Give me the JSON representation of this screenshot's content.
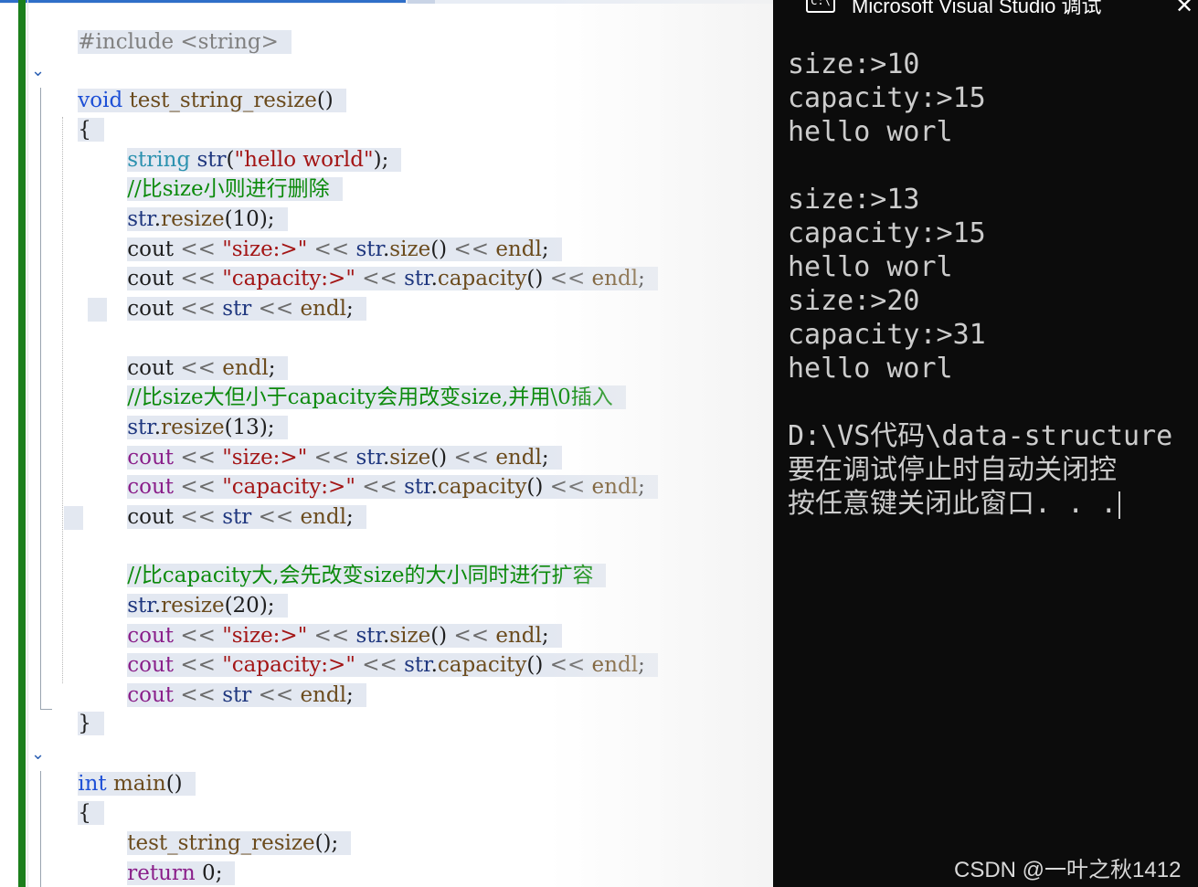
{
  "editor": {
    "include_line": "#include <string>",
    "func1": {
      "kw": "void",
      "name": "test_string_resize",
      "parens": "()"
    },
    "open_brace": "{",
    "close_brace": "}",
    "block1": {
      "decl": {
        "type": "string",
        "var": "str",
        "open": "(",
        "literal": "\"hello world\"",
        "close": ");"
      },
      "comment": "//比size小则进行删除",
      "resize": {
        "var": "str",
        "dot": ".",
        "fn": "resize",
        "arg": "(10);"
      }
    },
    "block2": {
      "comment": "//比size大但小于capacity会用改变size,并用\\0插入",
      "resize": {
        "var": "str",
        "dot": ".",
        "fn": "resize",
        "arg": "(13);"
      }
    },
    "block3": {
      "comment": "//比capacity大,会先改变size的大小同时进行扩容",
      "resize": {
        "var": "str",
        "dot": ".",
        "fn": "resize",
        "arg": "(20);"
      }
    },
    "cout_tokens": {
      "cout": "cout",
      "shl": "<<",
      "size_label": "\"size:>\"",
      "capacity_label": "\"capacity:>\"",
      "str": "str",
      "dot": ".",
      "size_fn": "size",
      "capacity_fn": "capacity",
      "call": "()",
      "endl": "endl",
      "semi": ";"
    },
    "func2": {
      "kw": "int",
      "name": "main",
      "parens": "()"
    },
    "main_call": "test_string_resize",
    "main_call_tail": "();",
    "return_kw": "return",
    "return_val": "0",
    "return_semi": ";"
  },
  "console": {
    "title": "Microsoft Visual Studio 调试",
    "icon_label": "C:\\",
    "close_label": "✕",
    "lines": [
      "size:>10",
      "capacity:>15",
      "hello worl",
      "",
      "size:>13",
      "capacity:>15",
      "hello worl",
      "size:>20",
      "capacity:>31",
      "hello worl",
      "",
      "D:\\VS代码\\data-structure",
      "要在调试停止时自动关闭控",
      "按任意键关闭此窗口. . ."
    ]
  },
  "watermark": "CSDN @一叶之秋1412"
}
